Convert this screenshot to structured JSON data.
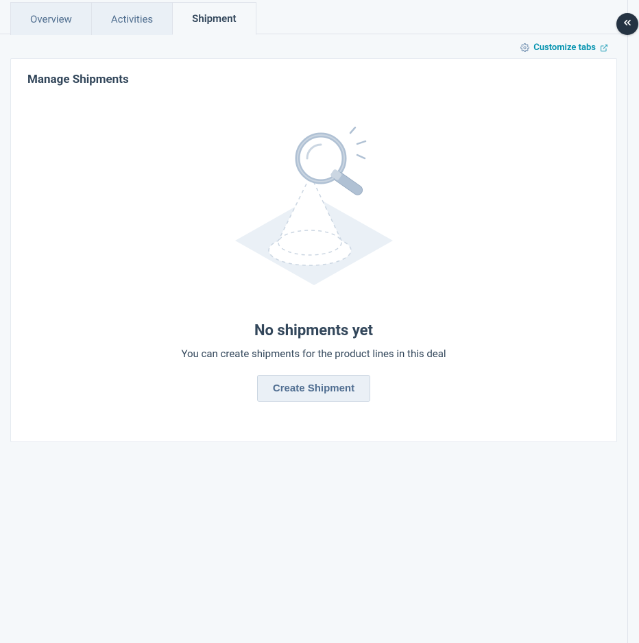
{
  "tabs": {
    "items": [
      {
        "label": "Overview",
        "active": false
      },
      {
        "label": "Activities",
        "active": false
      },
      {
        "label": "Shipment",
        "active": true
      }
    ],
    "customize_label": "Customize tabs"
  },
  "card": {
    "title": "Manage Shipments",
    "empty_title": "No shipments yet",
    "empty_subtitle": "You can create shipments for the product lines in this deal",
    "create_label": "Create Shipment"
  },
  "icons": {
    "gear": "gear-icon",
    "external": "external-link-icon",
    "collapse": "chevrons-left-icon",
    "empty_illustration": "magnifier-search-empty-icon"
  },
  "colors": {
    "accent": "#0091ae",
    "text": "#33475b",
    "muted": "#7c98b6",
    "button_bg": "#eaf0f6",
    "pill_bg": "#253342"
  }
}
